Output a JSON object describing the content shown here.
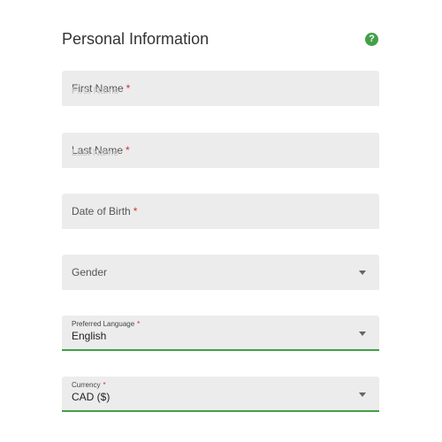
{
  "form": {
    "title": "Personal Information",
    "help_icon": "?",
    "fields": {
      "first_name": {
        "label": "First Name",
        "required_mark": "*"
      },
      "last_name": {
        "label": "Last Name",
        "required_mark": "*"
      },
      "dob": {
        "label": "Date of Birth",
        "required_mark": "*"
      },
      "gender": {
        "label": "Gender"
      },
      "language": {
        "label": "Preferred Language",
        "required_mark": "*",
        "value": "English"
      },
      "currency": {
        "label": "Currency",
        "required_mark": "*",
        "value": "CAD ($)"
      }
    }
  },
  "colors": {
    "accent": "#43a047",
    "required": "#d32f2f",
    "field_bg": "#ececec"
  }
}
